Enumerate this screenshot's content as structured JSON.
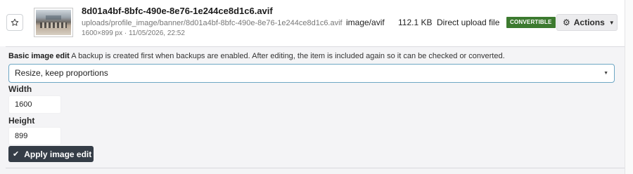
{
  "file": {
    "name": "8d01a4bf-8bfc-490e-8e76-1e244ce8d1c6.avif",
    "path": "uploads/profile_image/banner/8d01a4bf-8bfc-490e-8e76-1e244ce8d1c6.avif",
    "meta": "1600×899 px · 11/05/2026, 22:52",
    "mime": "image/avif",
    "size": "112.1 KB",
    "source": "Direct upload file",
    "badge": "CONVERTIBLE",
    "badge_color": "#3c7a2f"
  },
  "icons": {
    "favorite": "star-outline-icon",
    "actions": "gear-icon",
    "actions_caret": "caret-down-icon",
    "select_caret": "caret-down-icon",
    "apply": "check-icon"
  },
  "actions_label": "Actions",
  "edit": {
    "title": "Basic image edit",
    "description": " A backup is created first when backups are enabled. After editing, the item is included again so it can be checked or converted.",
    "mode_selected": "Resize, keep proportions",
    "width_label": "Width",
    "width_value": "1600",
    "height_label": "Height",
    "height_value": "899",
    "apply_label": "Apply image edit"
  }
}
